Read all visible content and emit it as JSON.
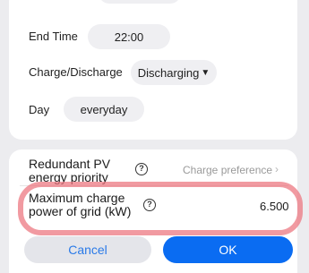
{
  "schedule": {
    "end_time_label": "End Time",
    "end_time_value": "22:00",
    "mode_label": "Charge/Discharge",
    "mode_value": "Discharging",
    "day_label": "Day",
    "day_value": "everyday"
  },
  "settings": {
    "redundant_pv": {
      "label_line1": "Redundant PV",
      "label_line2": "energy priority",
      "value": "Charge preference"
    },
    "max_grid_charge": {
      "label_line1": "Maximum charge",
      "label_line2": "power of grid (kW)",
      "value": "6.500"
    }
  },
  "buttons": {
    "cancel": "Cancel",
    "ok": "OK"
  },
  "colors": {
    "accent": "#0a6cf2",
    "highlight": "#ec737d"
  },
  "icons": {
    "help": "question-circle-icon",
    "dropdown": "triangle-down-icon",
    "chevron": "chevron-right-icon"
  }
}
